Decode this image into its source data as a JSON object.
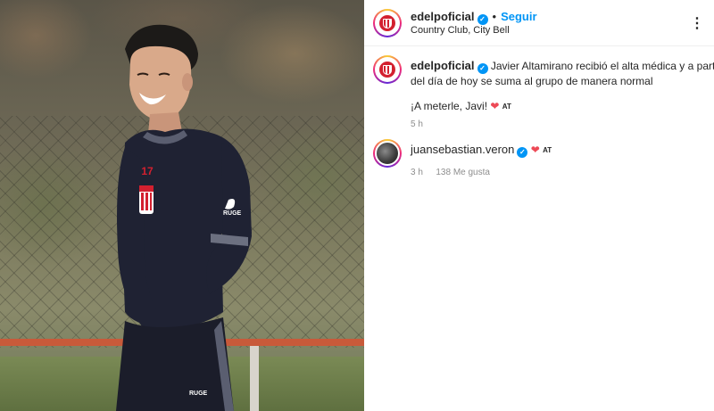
{
  "post": {
    "username": "edelpoficial",
    "follow_label": "Seguir",
    "location": "Country Club, City Bell",
    "more_label": "⋮"
  },
  "caption": {
    "username": "edelpoficial",
    "text_line1": "Javier Altamirano recibió el alta médica y a partir",
    "text_line2": "del día de hoy se suma al grupo de manera normal",
    "text_line3": "¡A meterle, Javi!",
    "flag_text": "AT",
    "time": "5 h"
  },
  "comments": [
    {
      "username": "juansebastian.veron",
      "flag_text": "AT",
      "time": "3 h",
      "likes": "138 Me gusta"
    }
  ],
  "photo": {
    "jersey_text": "RUGE",
    "sleeve_text": "RUGE",
    "shorts_text": "RUGE"
  },
  "colors": {
    "accent": "#0095f6",
    "heart": "#ed4956",
    "club_red": "#d3202f"
  }
}
